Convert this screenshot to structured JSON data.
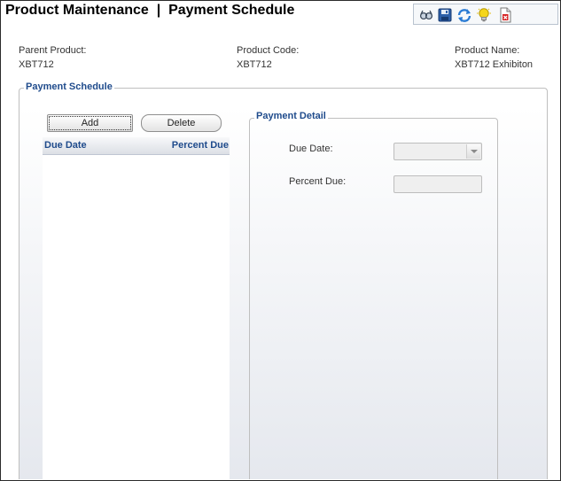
{
  "header": {
    "title": "Product Maintenance  |  Payment Schedule"
  },
  "toolbar": {
    "icons": [
      "search-icon",
      "save-icon",
      "refresh-icon",
      "lightbulb-icon",
      "delete-document-icon"
    ]
  },
  "product_info": {
    "parent_product_label": "Parent Product:",
    "parent_product_value": "XBT712",
    "product_code_label": "Product Code:",
    "product_code_value": "XBT712",
    "product_name_label": "Product Name:",
    "product_name_value": "XBT712 Exhibiton"
  },
  "payment_schedule": {
    "legend": "Payment Schedule",
    "add_label": "Add",
    "delete_label": "Delete",
    "columns": [
      "Due Date",
      "Percent Due"
    ],
    "rows": []
  },
  "payment_detail": {
    "legend": "Payment Detail",
    "due_date_label": "Due Date:",
    "due_date_value": "",
    "percent_due_label": "Percent Due:",
    "percent_due_value": ""
  },
  "colors": {
    "accent": "#1f4b8c",
    "border": "#bfbfbf"
  }
}
